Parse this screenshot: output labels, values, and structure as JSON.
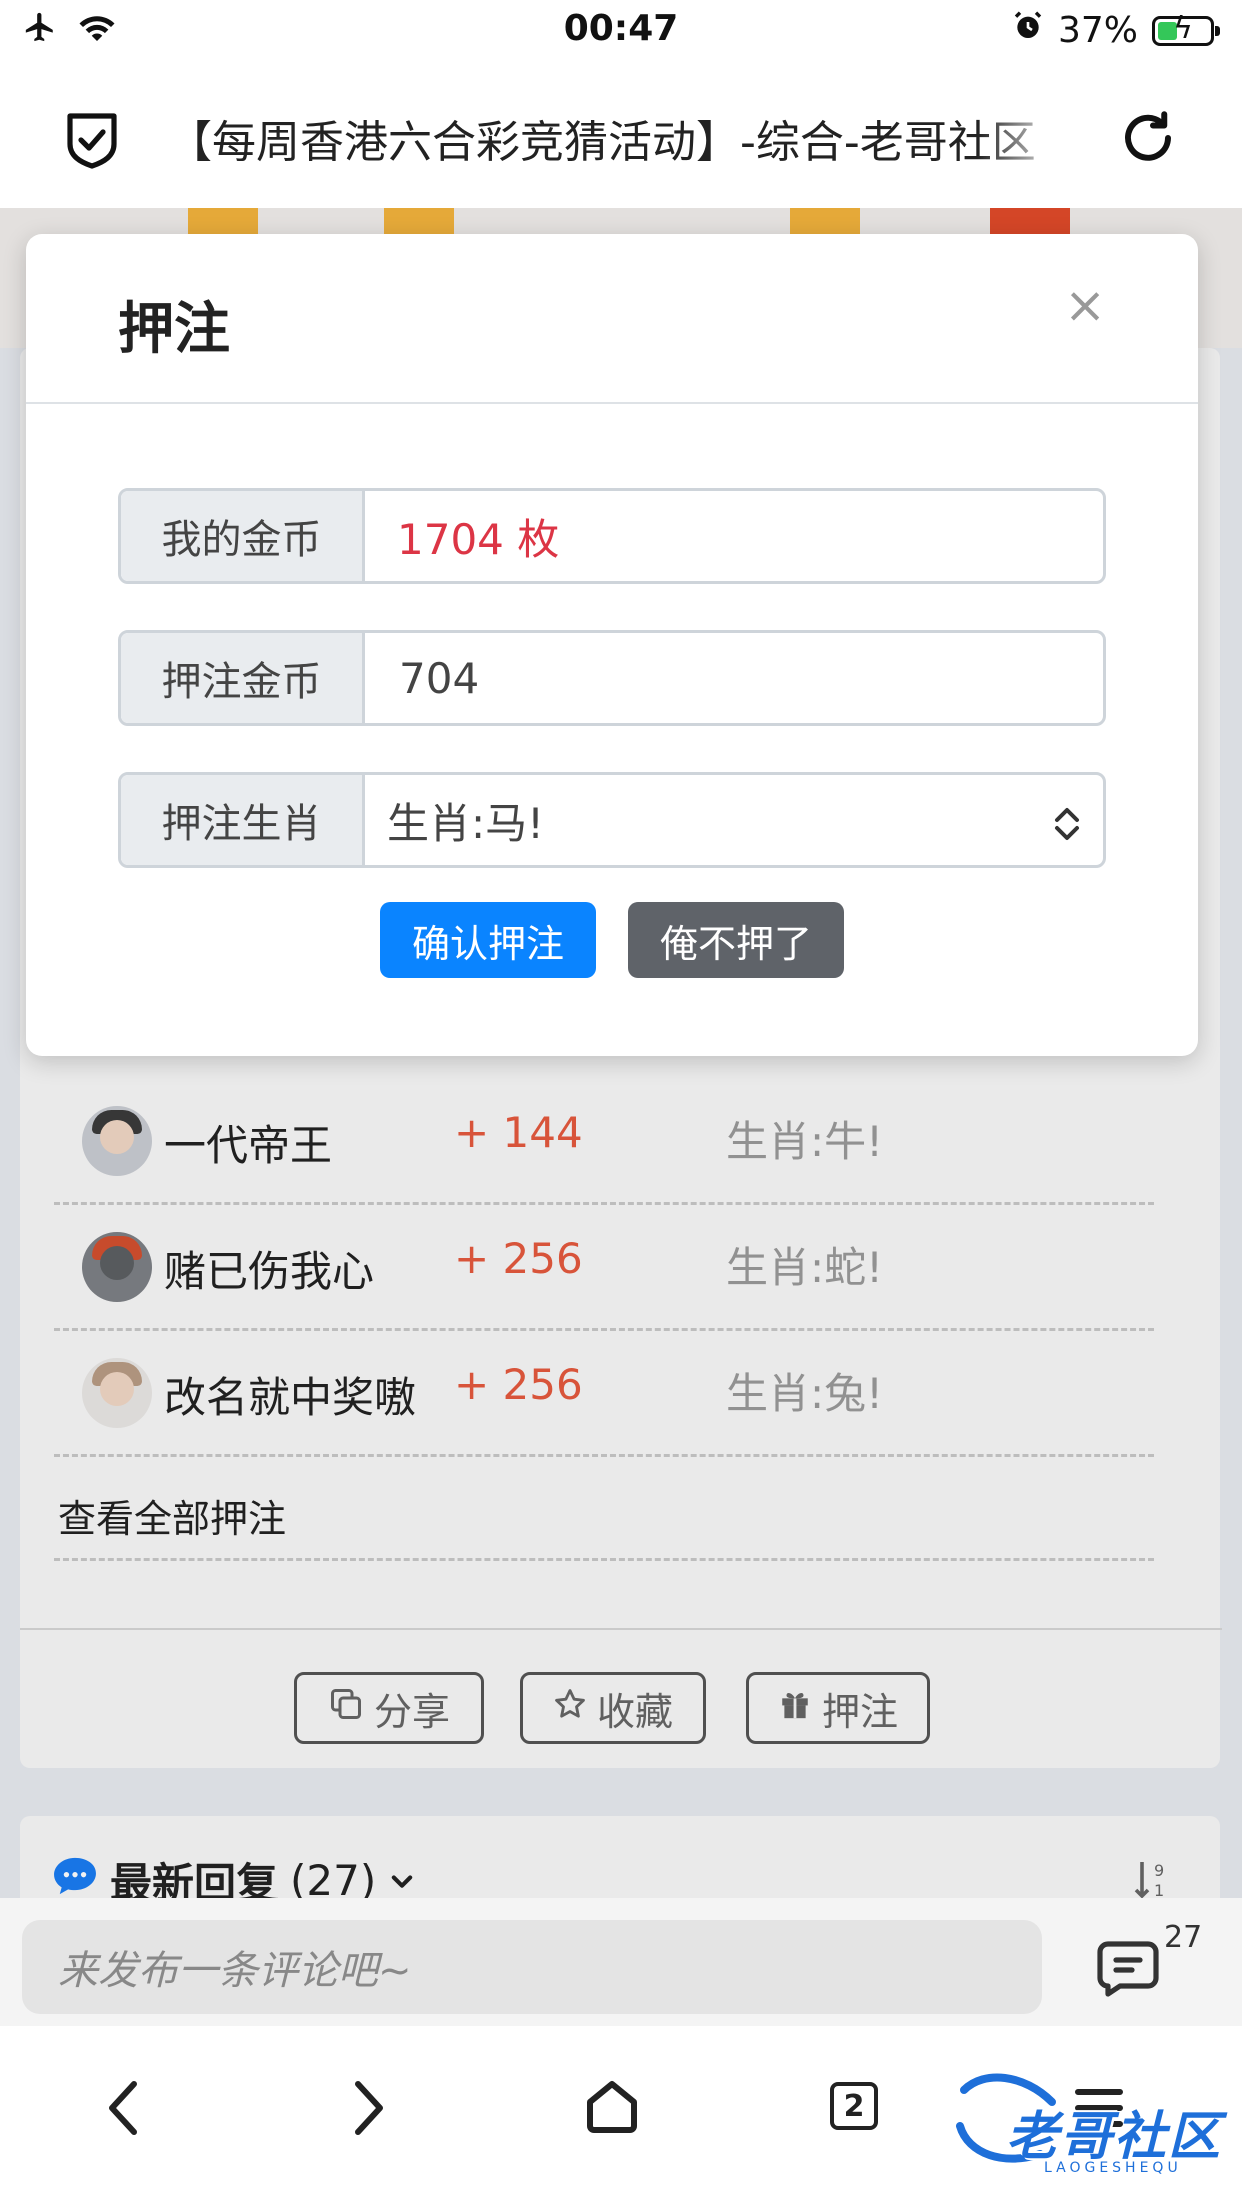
{
  "status_bar": {
    "time": "00:47",
    "battery_percent": "37%",
    "battery_level": 0.37
  },
  "nav": {
    "title": "【每周香港六合彩竞猜活动】-综合-老哥社区"
  },
  "modal": {
    "title": "押注",
    "close": "×",
    "coins_label": "我的金币",
    "coins_value": "1704 枚",
    "bet_label": "押注金币",
    "bet_value": "704",
    "zodiac_label": "押注生肖",
    "zodiac_value": "生肖:马!",
    "confirm_label": "确认押注",
    "cancel_label": "俺不押了"
  },
  "bets": [
    {
      "name": "一代帝王",
      "amount": "+ 144",
      "zodiac": "生肖:牛!"
    },
    {
      "name": "赌已伤我心",
      "amount": "+ 256",
      "zodiac": "生肖:蛇!"
    },
    {
      "name": "改名就中奖嗷",
      "amount": "+ 256",
      "zodiac": "生肖:兔!"
    }
  ],
  "view_all": "查看全部押注",
  "actions": {
    "share": "分享",
    "favorite": "收藏",
    "bet": "押注"
  },
  "replies": {
    "title": "最新回复",
    "count": "(27)"
  },
  "comment": {
    "placeholder": "来发布一条评论吧~",
    "count": "27"
  },
  "toolbar": {
    "tabs_count": "2"
  },
  "watermark": {
    "text": "老哥社区",
    "sub": "LAOGESHEQU"
  },
  "colors": {
    "primary": "#0a84ff",
    "secondary": "#5f6369",
    "danger": "#dc3545",
    "amount": "#e4593e"
  }
}
